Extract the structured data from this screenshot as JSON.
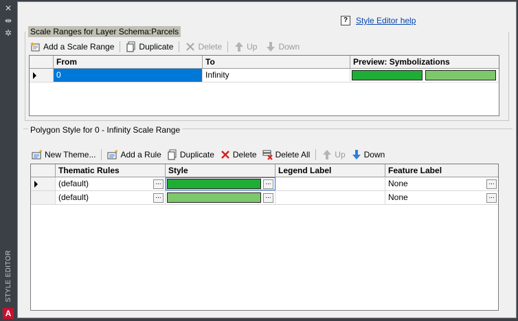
{
  "sidebar": {
    "title": "STYLE EDITOR",
    "logo": "A",
    "buttons": [
      {
        "icon": "close-icon",
        "glyph": "✕"
      },
      {
        "icon": "auto-hide-icon",
        "glyph": "⇹"
      },
      {
        "icon": "settings-icon",
        "glyph": "✲"
      }
    ]
  },
  "help": {
    "icon": "help-icon",
    "glyph": "?",
    "link": "Style Editor help"
  },
  "scale": {
    "title": "Scale Ranges for Layer Schema:Parcels",
    "toolbar": {
      "add": "Add a Scale Range",
      "duplicate": "Duplicate",
      "delete": "Delete",
      "up": "Up",
      "down": "Down"
    },
    "columns": [
      "From",
      "To",
      "Preview: Symbolizations"
    ],
    "rows": [
      {
        "from": "0",
        "to": "Infinity",
        "swatches": [
          "#1fad35",
          "#7dc86a"
        ]
      }
    ]
  },
  "polygon": {
    "title": "Polygon Style for 0 - Infinity Scale Range",
    "toolbar": {
      "new_theme": "New Theme...",
      "add_rule": "Add a Rule",
      "duplicate": "Duplicate",
      "delete": "Delete",
      "delete_all": "Delete All",
      "up": "Up",
      "down": "Down"
    },
    "columns": [
      "Thematic Rules",
      "Style",
      "Legend Label",
      "Feature Label"
    ],
    "rows": [
      {
        "rule": "(default)",
        "style_color": "#1fad35",
        "legend": "",
        "feature": "None"
      },
      {
        "rule": "(default)",
        "style_color": "#7dc86a",
        "legend": "",
        "feature": "None"
      }
    ],
    "ellipsis": "..."
  }
}
